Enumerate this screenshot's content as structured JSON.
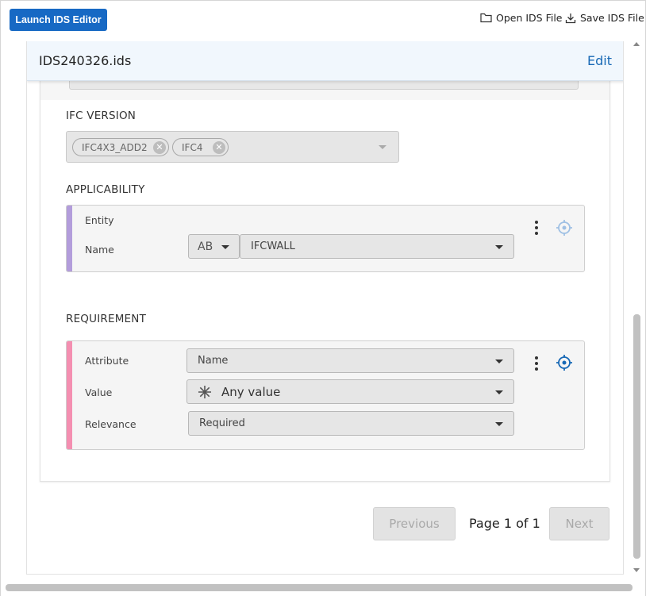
{
  "toolbar": {
    "launch_label": "Launch IDS Editor",
    "open_label": "Open IDS File",
    "save_label": "Save IDS File"
  },
  "panel": {
    "title": "IDS240326.ids",
    "edit_label": "Edit"
  },
  "ifc_version": {
    "label": "IFC VERSION",
    "chips": [
      "IFC4X3_ADD2",
      "IFC4"
    ]
  },
  "applicability": {
    "label": "APPLICABILITY",
    "accent": "#b39ddb",
    "facet_type": "Entity",
    "name_label": "Name",
    "value_type_icon": "AB",
    "name_value": "IFCWALL"
  },
  "requirement": {
    "label": "REQUIREMENT",
    "accent": "#f48fb1",
    "attribute_label": "Attribute",
    "attribute_value": "Name",
    "value_label": "Value",
    "value_value": "Any value",
    "relevance_label": "Relevance",
    "relevance_value": "Required"
  },
  "pagination": {
    "previous_label": "Previous",
    "page_text": "Page 1 of 1",
    "next_label": "Next"
  },
  "colors": {
    "primary": "#1769c4",
    "link": "#1768b5"
  }
}
